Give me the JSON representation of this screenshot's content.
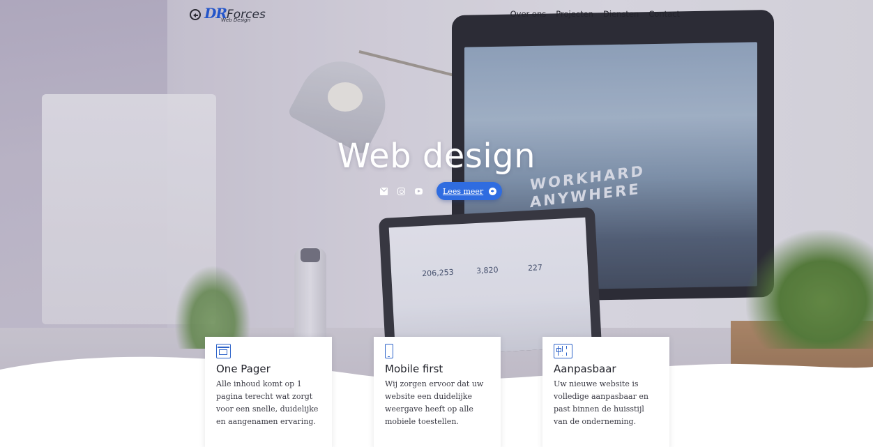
{
  "brand": {
    "logo_initials": "DR",
    "logo_name": "Forces",
    "logo_sub": "Web Design"
  },
  "nav": {
    "items": [
      {
        "label": "Over ons"
      },
      {
        "label": "Projecten"
      },
      {
        "label": "Diensten"
      },
      {
        "label": "Contact"
      }
    ]
  },
  "hero": {
    "title": "Web design",
    "cta_label": "Lees meer",
    "socials": [
      "mail-icon",
      "instagram-icon",
      "youtube-icon"
    ],
    "monitor_text": "WORKHARD ANYWHERE",
    "laptop_stats": [
      "206,253",
      "3,820",
      "227"
    ]
  },
  "features": [
    {
      "icon": "one-pager-icon",
      "title": "One Pager",
      "text": "Alle inhoud komt op 1 pagina terecht wat zorgt voor een snelle, duidelijke en aangenamen ervaring."
    },
    {
      "icon": "mobile-icon",
      "title": "Mobile first",
      "text": "Wij zorgen ervoor dat uw website een duidelijke weergave heeft op alle mobiele toestellen."
    },
    {
      "icon": "sliders-icon",
      "title": "Aanpasbaar",
      "text": "Uw nieuwe website is volledige aanpasbaar en past binnen de huisstijl van de onderneming."
    }
  ],
  "colors": {
    "accent": "#2f6ce0",
    "icon_blue": "#2d63c9",
    "text_dark": "#23232b"
  }
}
